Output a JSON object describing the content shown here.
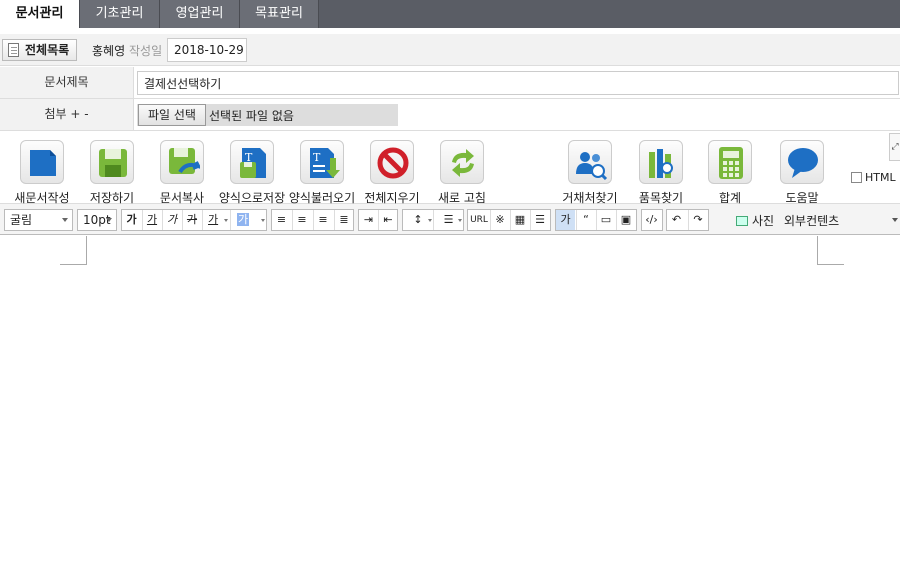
{
  "tabs": [
    {
      "label": "문서관리",
      "active": true
    },
    {
      "label": "기초관리",
      "active": false
    },
    {
      "label": "영업관리",
      "active": false
    },
    {
      "label": "목표관리",
      "active": false
    }
  ],
  "info": {
    "full_list_label": "전체목록",
    "author": "홍혜영",
    "date_label": "작성일",
    "date_value": "2018-10-29"
  },
  "form": {
    "title_label": "문서제목",
    "title_value": "결제선선택하기",
    "attach_label": "첨부 + -",
    "file_button": "파일 선택",
    "file_none": "선택된 파일 없음"
  },
  "toolbar": {
    "items": [
      {
        "label": "새문서작성",
        "icon": "new-document-icon"
      },
      {
        "label": "저장하기",
        "icon": "save-icon"
      },
      {
        "label": "문서복사",
        "icon": "copy-document-icon"
      },
      {
        "label": "양식으로저장",
        "icon": "save-template-icon"
      },
      {
        "label": "양식불러오기",
        "icon": "load-template-icon"
      },
      {
        "label": "전체지우기",
        "icon": "clear-all-icon"
      },
      {
        "label": "새로 고침",
        "icon": "refresh-icon"
      },
      {
        "label": "거채처찾기",
        "icon": "find-client-icon"
      },
      {
        "label": "품목찾기",
        "icon": "find-item-icon"
      },
      {
        "label": "합계",
        "icon": "calculator-icon"
      },
      {
        "label": "도움말",
        "icon": "help-icon"
      }
    ],
    "html_label": "HTML"
  },
  "editor_toolbar": {
    "font": "굴림",
    "size": "10pt",
    "bold": "가",
    "underline": "가",
    "italic": "가",
    "strike": "가",
    "font_color": "가",
    "bg_color": "가",
    "url_label": "URL",
    "special_char": "※",
    "blockquote": "“",
    "photo_label": "사진",
    "external_label": "외부컨텐츠"
  },
  "colors": {
    "tab_bg": "#6b6e76",
    "tabbar_bg": "#5a5d65",
    "blue_icon": "#1e6fc4",
    "green_icon": "#7ab83b"
  }
}
